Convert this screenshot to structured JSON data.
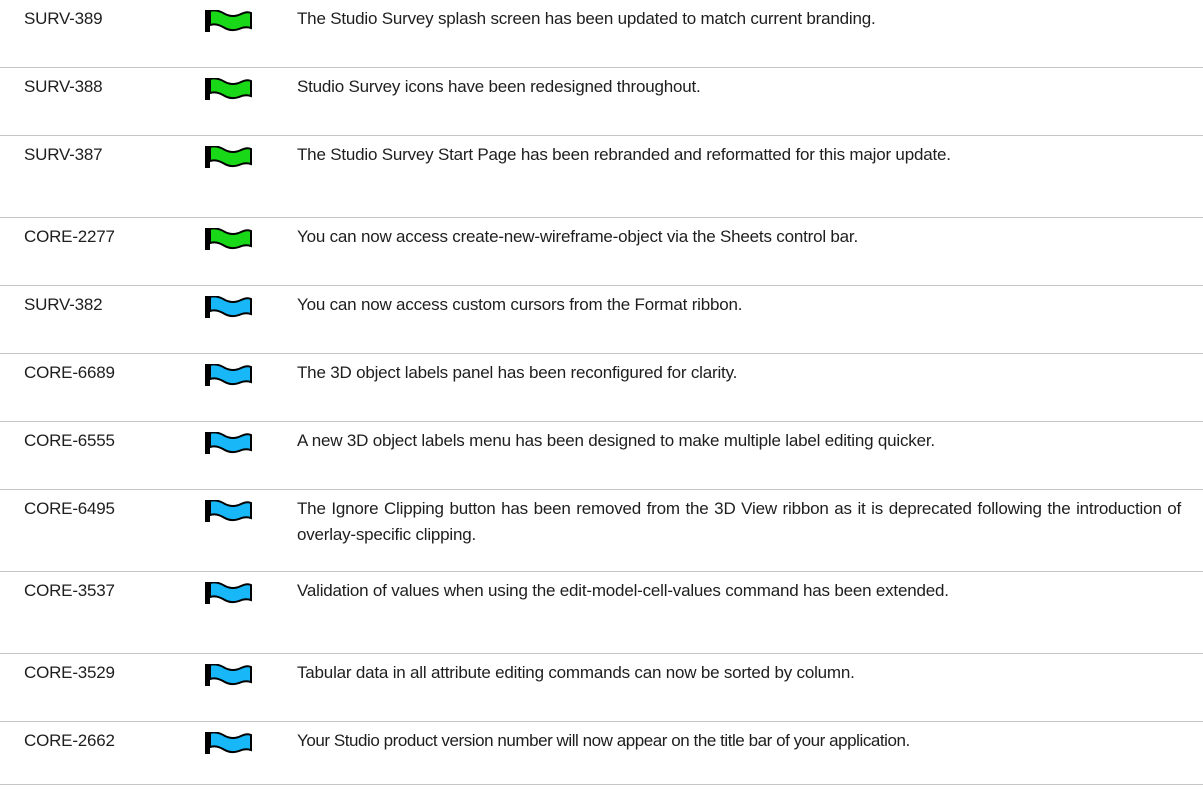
{
  "colors": {
    "flag_green": "#18d818",
    "flag_blue": "#18b8f8",
    "flag_pole": "#000000",
    "divider": "#c4c4c4"
  },
  "items": [
    {
      "id": "SURV-389",
      "flag": "green-flag-icon",
      "description": "The Studio Survey splash screen has been updated to match current branding."
    },
    {
      "id": "SURV-388",
      "flag": "green-flag-icon",
      "description": "Studio Survey icons have been redesigned throughout."
    },
    {
      "id": "SURV-387",
      "flag": "green-flag-icon",
      "description": "The Studio Survey Start Page has been rebranded and reformatted for this major update."
    },
    {
      "id": "CORE-2277",
      "flag": "green-flag-icon",
      "description": "You can now access create-new-wireframe-object via the Sheets control bar."
    },
    {
      "id": "SURV-382",
      "flag": "blue-flag-icon",
      "description": "You can now access custom cursors from the Format ribbon."
    },
    {
      "id": "CORE-6689",
      "flag": "blue-flag-icon",
      "description": "The 3D object labels panel has been reconfigured for clarity."
    },
    {
      "id": "CORE-6555",
      "flag": "blue-flag-icon",
      "description": "A new 3D object labels menu has been designed to make multiple label editing quicker."
    },
    {
      "id": "CORE-6495",
      "flag": "blue-flag-icon",
      "description": "The Ignore Clipping button has been removed from the 3D View ribbon as it is deprecated following the introduction of overlay-specific clipping."
    },
    {
      "id": "CORE-3537",
      "flag": "blue-flag-icon",
      "description": "Validation of values when using the edit-model-cell-values command has been extended."
    },
    {
      "id": "CORE-3529",
      "flag": "blue-flag-icon",
      "description": "Tabular data in all attribute editing commands can now be sorted by column."
    },
    {
      "id": "CORE-2662",
      "flag": "blue-flag-icon",
      "description": "Your Studio product version number will now appear on the title bar of your application."
    }
  ]
}
